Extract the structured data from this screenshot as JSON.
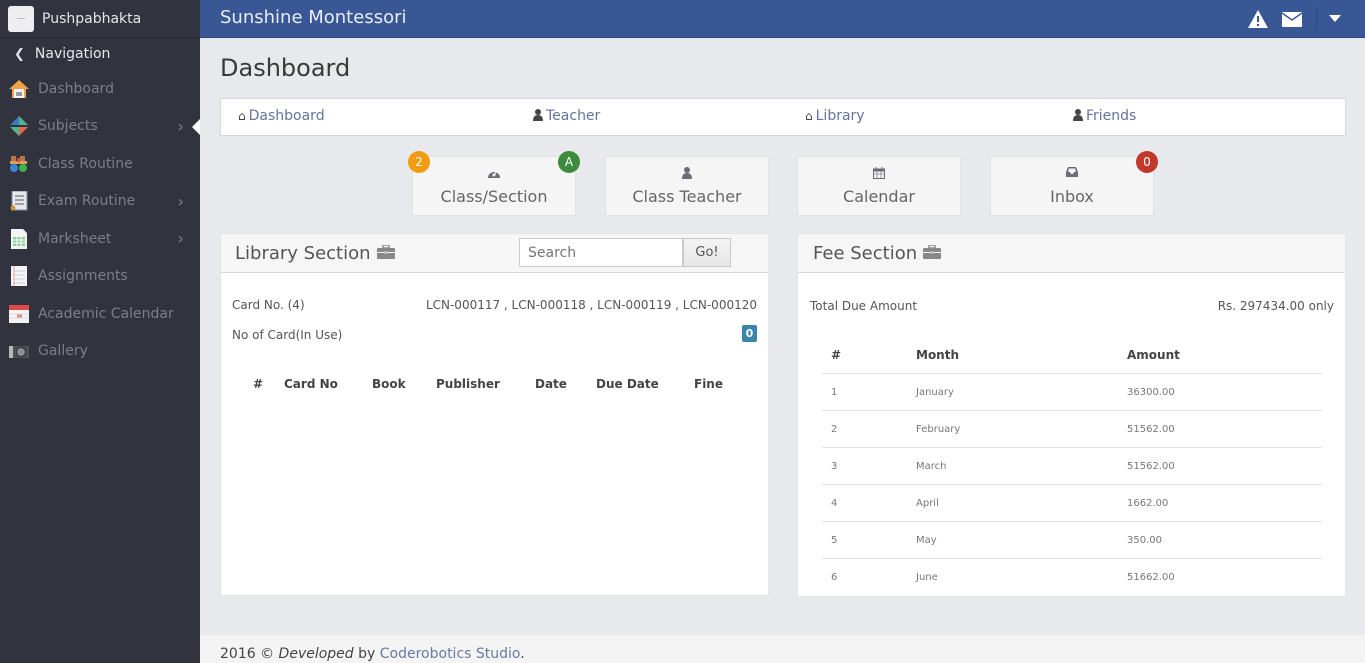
{
  "sidebar": {
    "brand": "Pushpabhakta",
    "nav_heading": "Navigation",
    "items": [
      {
        "label": "Dashboard",
        "icon": "home-icon",
        "has_submenu": false
      },
      {
        "label": "Subjects",
        "icon": "subjects-icon",
        "has_submenu": true,
        "active": true
      },
      {
        "label": "Class Routine",
        "icon": "class-routine-icon",
        "has_submenu": false
      },
      {
        "label": "Exam Routine",
        "icon": "exam-routine-icon",
        "has_submenu": true
      },
      {
        "label": "Marksheet",
        "icon": "marksheet-icon",
        "has_submenu": true
      },
      {
        "label": "Assignments",
        "icon": "assignments-icon",
        "has_submenu": false
      },
      {
        "label": "Academic Calendar",
        "icon": "calendar-icon",
        "has_submenu": false
      },
      {
        "label": "Gallery",
        "icon": "camera-icon",
        "has_submenu": false
      }
    ]
  },
  "topbar": {
    "school_name": "Sunshine Montessori",
    "icons": [
      "warning-icon",
      "envelope-icon",
      "caret-down-icon"
    ]
  },
  "page": {
    "title": "Dashboard"
  },
  "quicknav": [
    {
      "label": "Dashboard",
      "icon": "home-icon"
    },
    {
      "label": "Teacher",
      "icon": "user-icon"
    },
    {
      "label": "Library",
      "icon": "home-icon"
    },
    {
      "label": "Friends",
      "icon": "user-icon"
    }
  ],
  "tiles": [
    {
      "label": "Class/Section",
      "icon": "dashboard-gauge-icon",
      "badge_left": "2",
      "badge_right": "A"
    },
    {
      "label": "Class Teacher",
      "icon": "user-icon"
    },
    {
      "label": "Calendar",
      "icon": "calendar-icon"
    },
    {
      "label": "Inbox",
      "icon": "inbox-icon",
      "badge_right": "0"
    }
  ],
  "colors": {
    "brand_blue": "#3a5795",
    "sidebar": "#31343f",
    "badge_orange": "#f39c12",
    "badge_green": "#3d8b3d",
    "badge_red": "#c0392b",
    "info": "#3a86a8"
  },
  "library": {
    "title": "Library Section",
    "search_placeholder": "Search",
    "go_label": "Go!",
    "card_label": "Card No. (4)",
    "card_values": "LCN-000117 , LCN-000118 , LCN-000119 , LCN-000120",
    "in_use_label": "No of Card(In Use)",
    "in_use_count": "0",
    "columns": [
      "#",
      "Card No",
      "Book",
      "Publisher",
      "Date",
      "Due Date",
      "Fine"
    ]
  },
  "fee": {
    "title": "Fee Section",
    "total_label": "Total Due Amount",
    "total_value": "Rs. 297434.00 only",
    "columns": [
      "#",
      "Month",
      "Amount"
    ],
    "rows": [
      {
        "n": "1",
        "month": "January",
        "amount": "36300.00"
      },
      {
        "n": "2",
        "month": "February",
        "amount": "51562.00"
      },
      {
        "n": "3",
        "month": "March",
        "amount": "51562.00"
      },
      {
        "n": "4",
        "month": "April",
        "amount": "1662.00"
      },
      {
        "n": "5",
        "month": "May",
        "amount": "350.00"
      },
      {
        "n": "6",
        "month": "June",
        "amount": "51662.00"
      }
    ]
  },
  "footer": {
    "prefix": "2016 ©",
    "developed": "Developed",
    "by": "by",
    "company": "Coderobotics Studio",
    "suffix": "."
  }
}
